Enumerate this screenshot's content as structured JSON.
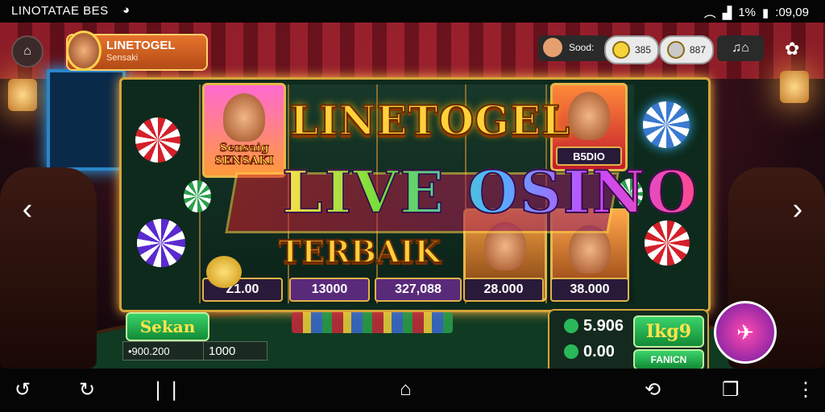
{
  "status": {
    "title": "LINOTATAE BES",
    "right_text": "1%",
    "time": ":09,09"
  },
  "profile": {
    "name": "LINETOGEL",
    "subtitle": "Sensaki"
  },
  "topbar": {
    "label": "Sood:",
    "pill1": "385",
    "pill2": "887"
  },
  "banner": {
    "line1": "LINETOGEL",
    "line2": "LIVE OSINO",
    "line3": "TERBAIK"
  },
  "cards": {
    "left_card_text": "Sensaig SENSAKI",
    "top_right_value": "B5DIO",
    "values": [
      "Z1.00",
      "13000",
      "327,088",
      "28.000",
      "38.000"
    ]
  },
  "bottom_left": {
    "button": "Sekan",
    "field1": "•900.200",
    "field2": "1000"
  },
  "right_panel": {
    "balance": "5.906",
    "win": "0.00",
    "spin_label": "Ikg9",
    "small_label": "FANICN"
  },
  "colors": {
    "gold": "#d6a43a",
    "green_button": "#2ab85a",
    "board_bg": "#0d2a1c"
  },
  "icons": {
    "nav": [
      "rotate-left-icon",
      "refresh-icon",
      "split-icon",
      "home-icon",
      "rotate-icon",
      "overview-icon",
      "more-icon"
    ]
  }
}
